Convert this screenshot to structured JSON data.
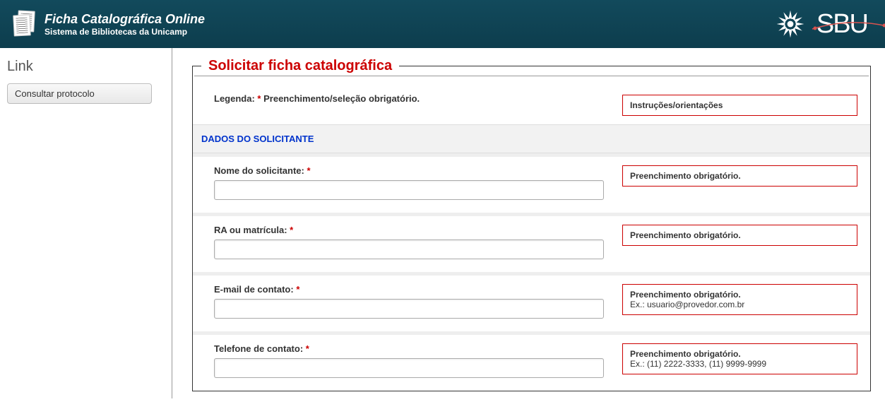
{
  "header": {
    "title": "Ficha Catalográfica Online",
    "subtitle": "Sistema de Bibliotecas da Unicamp",
    "sbu_text": "SBU"
  },
  "sidebar": {
    "heading": "Link",
    "consult_button": "Consultar protocolo"
  },
  "form": {
    "legend": "Solicitar ficha catalográfica",
    "caption_label": "Legenda:",
    "caption_star": "*",
    "caption_text": "Preenchimento/seleção obrigatório.",
    "instructions_box": "Instruções/orientações",
    "section_solicitante": "DADOS DO SOLICITANTE",
    "fields": {
      "nome": {
        "label": "Nome do solicitante:",
        "value": "",
        "hint_main": "Preenchimento obrigatório.",
        "hint_sub": ""
      },
      "ra": {
        "label": "RA ou matrícula:",
        "value": "",
        "hint_main": "Preenchimento obrigatório.",
        "hint_sub": ""
      },
      "email": {
        "label": "E-mail de contato:",
        "value": "",
        "hint_main": "Preenchimento obrigatório.",
        "hint_sub": "Ex.: usuario@provedor.com.br"
      },
      "telefone": {
        "label": "Telefone de contato:",
        "value": "",
        "hint_main": "Preenchimento obrigatório.",
        "hint_sub": "Ex.: (11) 2222-3333, (11) 9999-9999"
      }
    }
  }
}
